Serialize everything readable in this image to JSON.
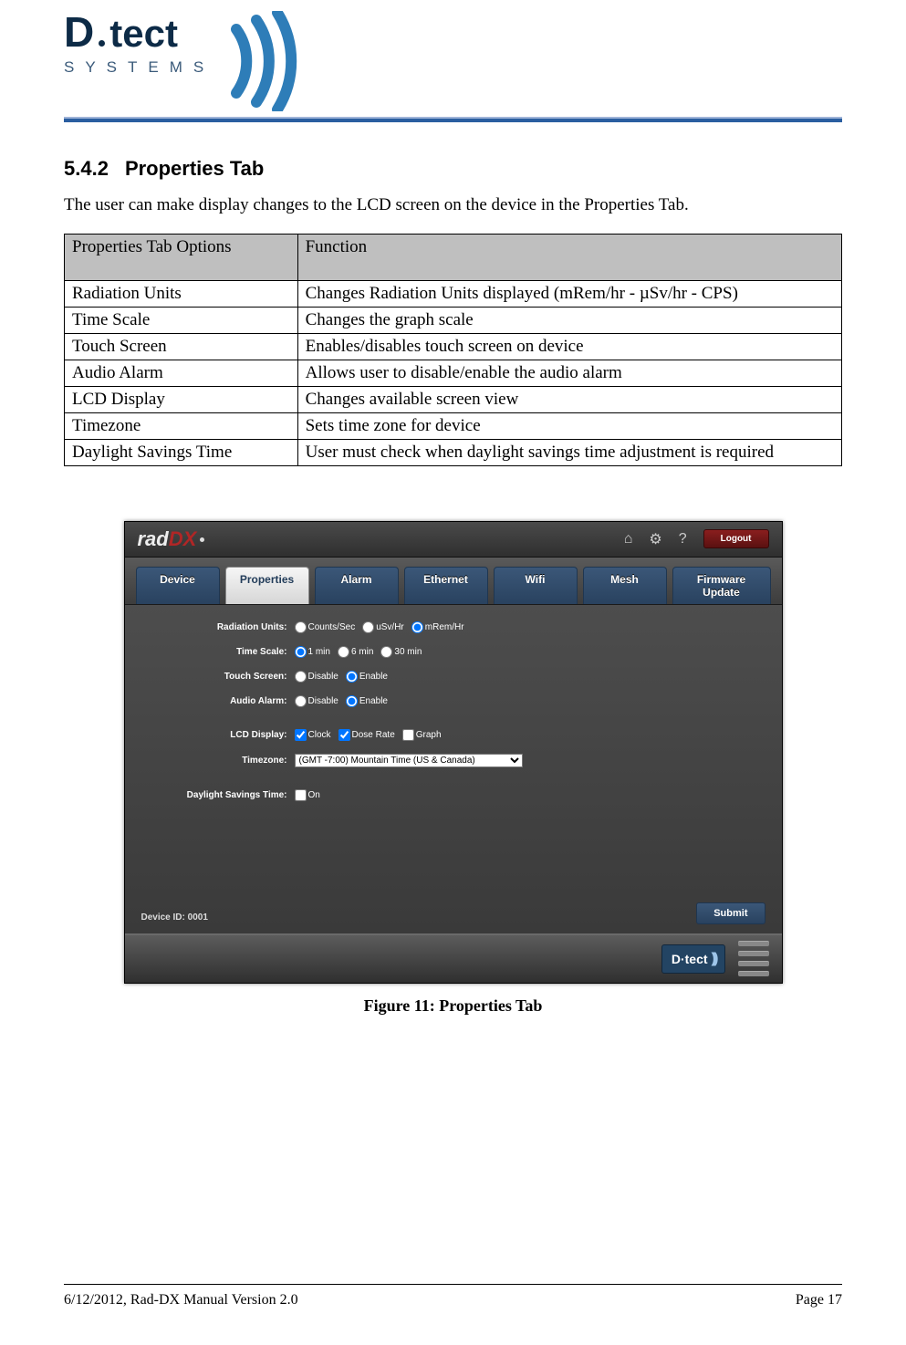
{
  "logo": {
    "line1": "D",
    "dot": "·",
    "line2": "tect",
    "sub": "SYSTEMS",
    "tm": "™"
  },
  "section": {
    "num": "5.4.2",
    "title": "Properties Tab"
  },
  "intro": "The user can make display changes to the LCD screen on the device in the Properties Tab.",
  "table": {
    "head": {
      "c1": "Properties Tab Options",
      "c2": "Function"
    },
    "rows": [
      {
        "c1": "Radiation Units",
        "c2": "Changes Radiation Units displayed (mRem/hr - µSv/hr - CPS)"
      },
      {
        "c1": "Time Scale",
        "c2": "Changes the graph scale"
      },
      {
        "c1": "Touch Screen",
        "c2": "Enables/disables touch screen on device"
      },
      {
        "c1": "Audio Alarm",
        "c2": "Allows user to disable/enable the audio alarm"
      },
      {
        "c1": "LCD Display",
        "c2": "Changes available screen view"
      },
      {
        "c1": "Timezone",
        "c2": "Sets time zone for device"
      },
      {
        "c1": "Daylight Savings Time",
        "c2": "User must check when daylight savings time adjustment is required"
      }
    ]
  },
  "app": {
    "brand_rad": "rad",
    "brand_dx": "DX",
    "icons": {
      "home": "⌂",
      "gear": "⚙",
      "help": "?"
    },
    "logout": "Logout",
    "tabs": [
      "Device",
      "Properties",
      "Alarm",
      "Ethernet",
      "Wifi",
      "Mesh",
      "Firmware Update"
    ],
    "active_tab": 1,
    "form": {
      "radiation": {
        "label": "Radiation Units:",
        "opts": [
          "Counts/Sec",
          "uSv/Hr",
          "mRem/Hr"
        ],
        "sel": 2
      },
      "timescale": {
        "label": "Time Scale:",
        "opts": [
          "1 min",
          "6 min",
          "30 min"
        ],
        "sel": 0
      },
      "touch": {
        "label": "Touch Screen:",
        "opts": [
          "Disable",
          "Enable"
        ],
        "sel": 1
      },
      "audio": {
        "label": "Audio Alarm:",
        "opts": [
          "Disable",
          "Enable"
        ],
        "sel": 1
      },
      "lcd": {
        "label": "LCD Display:",
        "opts": [
          "Clock",
          "Dose Rate",
          "Graph"
        ],
        "checked": [
          true,
          true,
          false
        ]
      },
      "tz": {
        "label": "Timezone:",
        "value": "(GMT -7:00) Mountain Time (US & Canada)"
      },
      "dst": {
        "label": "Daylight Savings Time:",
        "opt": "On",
        "checked": false
      }
    },
    "device_id": "Device ID: 0001",
    "submit": "Submit",
    "mini_logo": "D·tect"
  },
  "caption": "Figure 11: Properties Tab",
  "footer": {
    "left": "6/12/2012, Rad-DX Manual Version 2.0",
    "right": "Page 17"
  }
}
